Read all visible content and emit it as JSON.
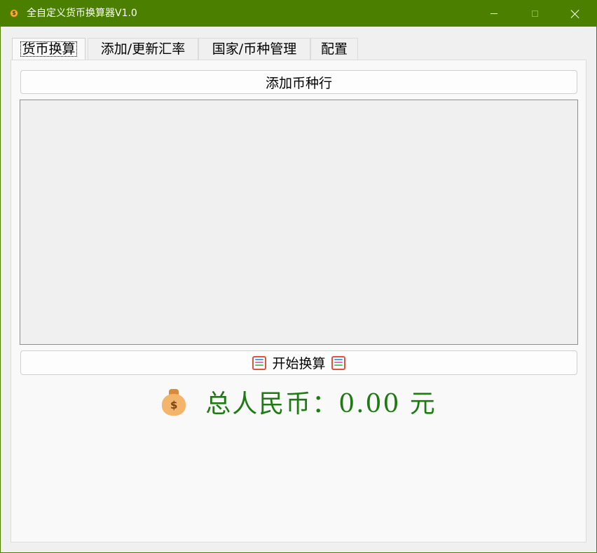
{
  "window": {
    "title": "全自定义货币换算器V1.0",
    "icon": "coin-icon"
  },
  "controls": {
    "minimize": "minimize-icon",
    "maximize": "maximize-icon",
    "close": "close-icon"
  },
  "tabs": [
    {
      "label": "货币换算",
      "active": true
    },
    {
      "label": "添加/更新汇率",
      "active": false
    },
    {
      "label": "国家/币种管理",
      "active": false
    },
    {
      "label": "配置",
      "active": false
    }
  ],
  "main": {
    "add_row_label": "添加币种行",
    "start_label": "开始换算",
    "total_text": "总人民币：0.00 元",
    "icons": {
      "start_left": "abacus-icon",
      "start_right": "abacus-icon",
      "total": "money-bag-icon"
    }
  },
  "colors": {
    "titlebar": "#4b7f00",
    "total_text": "#1f7a14"
  }
}
